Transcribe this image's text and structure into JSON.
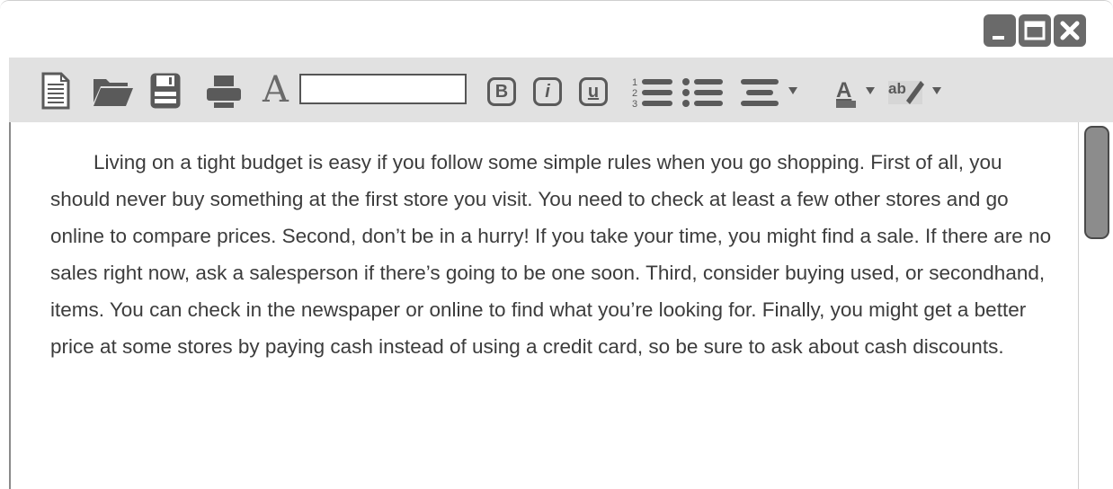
{
  "window": {
    "controls": {
      "minimize": "minimize-icon",
      "maximize": "maximize-icon",
      "close": "close-icon"
    }
  },
  "toolbar": {
    "icons": [
      "new-document-icon",
      "open-folder-icon",
      "save-icon",
      "print-icon"
    ],
    "font_label": "A",
    "font_size_value": "",
    "bold_label": "B",
    "italic_label": "i",
    "underline_label": "u",
    "numbered_list_digits": [
      "1",
      "2",
      "3"
    ],
    "text_color_label": "A",
    "highlight_label": "ab"
  },
  "document": {
    "text": "Living on a tight budget is easy if you follow some simple rules when you go shopping. First of all, you should never buy something at the first store you visit. You need to check at least a few other stores and go online to compare prices. Second, don’t be in a hurry! If you take your time, you might find a sale. If there are no sales right now, ask a salesperson if there’s going to be one soon. Third, consider buying used, or secondhand, items. You can check in the newspaper or online to find what you’re looking for. Finally, you might get a better price at some stores by paying cash instead of using a credit card, so be sure to ask about cash discounts."
  },
  "colors": {
    "toolbar_bg": "#e1e1e1",
    "icon": "#5a5a5a",
    "text": "#3c3c3c",
    "scroll_thumb": "#8c8c8c"
  }
}
